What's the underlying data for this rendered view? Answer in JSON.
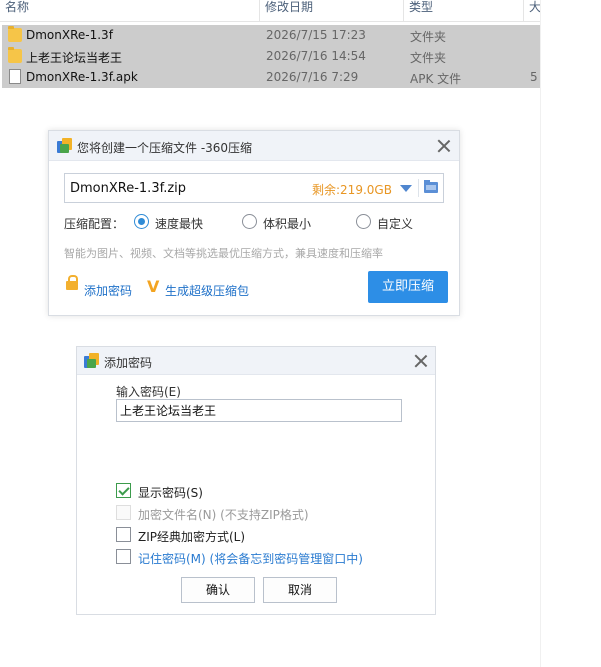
{
  "file_list": {
    "columns": {
      "name": "名称",
      "date": "修改日期",
      "type": "类型",
      "size": "大"
    },
    "rows": [
      {
        "name": "DmonXRe-1.3f",
        "date": "2026/7/15 17:23",
        "type": "文件夹",
        "size": "",
        "icon": "folder-icon"
      },
      {
        "name": "上老王论坛当老王",
        "date": "2026/7/16 14:54",
        "type": "文件夹",
        "size": "",
        "icon": "folder-icon"
      },
      {
        "name": "DmonXRe-1.3f.apk",
        "date": "2026/7/16 7:29",
        "type": "APK 文件",
        "size": "5",
        "icon": "file-icon"
      }
    ]
  },
  "compress_dialog": {
    "title": "您将创建一个压缩文件 -360压缩",
    "filename": "DmonXRe-1.3f.zip",
    "free_space": "剩余:219.0GB",
    "config_label": "压缩配置：",
    "options": [
      {
        "label": "速度最快",
        "selected": true
      },
      {
        "label": "体积最小",
        "selected": false
      },
      {
        "label": "自定义",
        "selected": false
      }
    ],
    "hint": "智能为图片、视频、文档等挑选最优压缩方式，兼具速度和压缩率",
    "add_password_link": "添加密码",
    "super_package_link": "生成超级压缩包",
    "compress_button": "立即压缩",
    "accent_color": "#2d8ee6",
    "free_space_color": "#e89623"
  },
  "password_dialog": {
    "title": "添加密码",
    "label": "输入密码(E)",
    "password_value": "上老王论坛当老王",
    "options": [
      {
        "label": "显示密码(S)",
        "note": "",
        "checked": true,
        "disabled": false
      },
      {
        "label": "加密文件名(N)",
        "note": "(不支持ZIP格式)",
        "checked": false,
        "disabled": true
      },
      {
        "label": "ZIP经典加密方式(L)",
        "note": "",
        "checked": false,
        "disabled": false
      },
      {
        "label": "记住密码(M)",
        "note": "(将会备忘到密码管理窗口中)",
        "checked": false,
        "disabled": false
      }
    ],
    "ok_button": "确认",
    "cancel_button": "取消"
  }
}
